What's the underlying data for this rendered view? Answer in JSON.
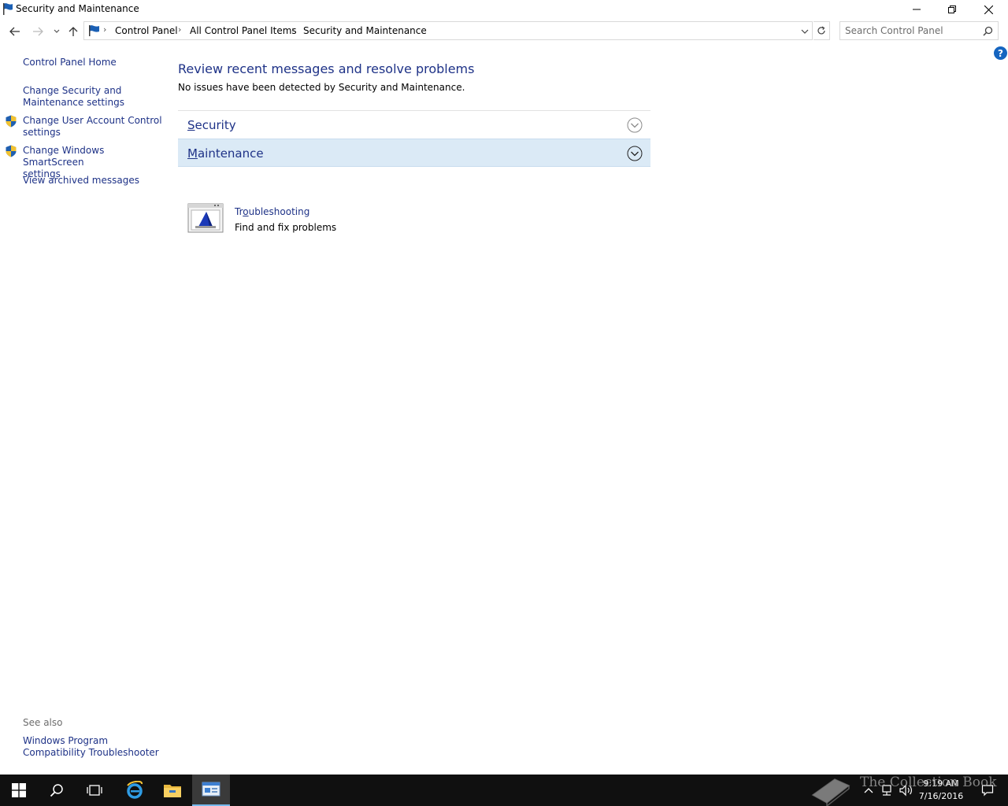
{
  "window": {
    "title": "Security and Maintenance"
  },
  "address_bar": {
    "breadcrumbs": [
      "Control Panel",
      "All Control Panel Items",
      "Security and Maintenance"
    ]
  },
  "search": {
    "placeholder": "Search Control Panel"
  },
  "sidebar": {
    "items": [
      {
        "label_line1": "Control Panel Home",
        "label_line2": "",
        "shield": false
      },
      {
        "label_line1": "Change Security and",
        "label_line2": "Maintenance settings",
        "shield": false
      },
      {
        "label_line1": "Change User Account Control",
        "label_line2": "settings",
        "shield": true
      },
      {
        "label_line1": "Change Windows SmartScreen",
        "label_line2": "settings",
        "shield": true
      },
      {
        "label_line1": "View archived messages",
        "label_line2": "",
        "shield": false
      }
    ],
    "see_also": {
      "heading": "See also",
      "link_line1": "Windows Program",
      "link_line2": "Compatibility Troubleshooter"
    }
  },
  "main": {
    "title": "Review recent messages and resolve problems",
    "subtitle": "No issues have been detected by Security and Maintenance.",
    "sections": [
      {
        "first_letter": "S",
        "rest": "ecurity",
        "expanded": false
      },
      {
        "first_letter": "M",
        "rest": "aintenance",
        "expanded": true
      }
    ],
    "troubleshooting": {
      "link_pre": "Tr",
      "link_underlined": "o",
      "link_post": "ubleshooting",
      "description": "Find and fix problems"
    }
  },
  "taskbar": {
    "clock_time": "9:19 AM",
    "clock_date": "7/16/2016",
    "watermark": "The Collection Book"
  },
  "colors": {
    "link": "#1e3287",
    "maintenance_bg": "#dbeaf6",
    "taskbar_bg": "#101010",
    "help_blue": "#1565c0"
  }
}
